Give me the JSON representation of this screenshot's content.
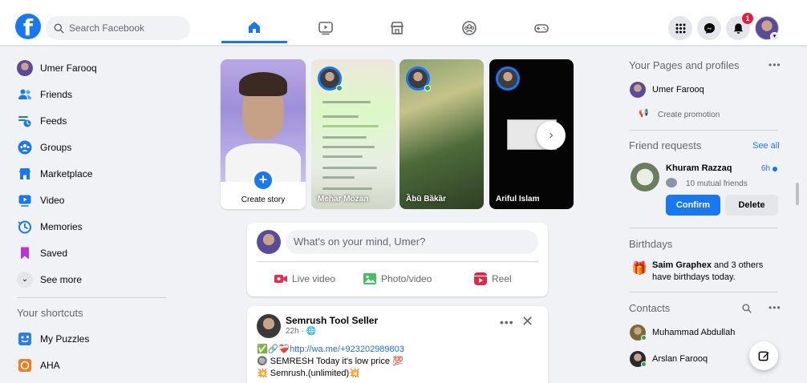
{
  "header": {
    "search_placeholder": "Search Facebook",
    "logo_glyph": "f",
    "notifications_count": "1"
  },
  "sidebar": {
    "items": [
      {
        "label": "Umer Farooq",
        "icon": "profile-avatar"
      },
      {
        "label": "Friends",
        "icon": "friends-icon"
      },
      {
        "label": "Feeds",
        "icon": "feeds-icon"
      },
      {
        "label": "Groups",
        "icon": "groups-icon"
      },
      {
        "label": "Marketplace",
        "icon": "marketplace-icon"
      },
      {
        "label": "Video",
        "icon": "video-icon"
      },
      {
        "label": "Memories",
        "icon": "memories-icon"
      },
      {
        "label": "Saved",
        "icon": "saved-icon"
      },
      {
        "label": "See more",
        "icon": "chevron-down-icon"
      }
    ],
    "shortcuts_heading": "Your shortcuts",
    "shortcuts": [
      {
        "label": "My Puzzles",
        "icon": "puzzle-app-icon"
      },
      {
        "label": "AHA",
        "icon": "aha-app-icon"
      }
    ]
  },
  "stories": {
    "create_label": "Create story",
    "items": [
      {
        "name": "Mehar Mozan"
      },
      {
        "name": "Ȁbū Bȁkȁr"
      },
      {
        "name": "Ariful Islam"
      }
    ]
  },
  "composer": {
    "placeholder": "What's on your mind, Umer?",
    "live_label": "Live video",
    "photo_label": "Photo/video",
    "reel_label": "Reel"
  },
  "post": {
    "author": "Semrush Tool Seller",
    "time": "22h",
    "line1_prefix": "✅🔗❤️‍🩹",
    "line1_link": "http://wa.me/+923202989803",
    "line2": "🔘 SEMRESH Today it's low price 💯",
    "line3": "💥 Semrush.(unlimited)💥"
  },
  "right": {
    "pages_heading": "Your Pages and profiles",
    "page_name": "Umer Farooq",
    "create_promotion": "Create promotion",
    "friend_requests_heading": "Friend requests",
    "see_all": "See all",
    "request_name": "Khuram Razzaq",
    "request_time": "6h",
    "mutual_friends": "10 mutual friends",
    "confirm_label": "Confirm",
    "delete_label": "Delete",
    "birthdays_heading": "Birthdays",
    "birthday_name": "Saim Graphex",
    "birthday_rest": " and 3 others",
    "birthday_line2": "have birthdays today.",
    "contacts_heading": "Contacts",
    "contacts": [
      {
        "name": "Muhammad Abdullah"
      },
      {
        "name": "Arslan Farooq"
      }
    ]
  },
  "colors": {
    "brand": "#1877f2",
    "background": "#f0f2f5",
    "notification": "#e41e3f",
    "online": "#31a24c"
  }
}
